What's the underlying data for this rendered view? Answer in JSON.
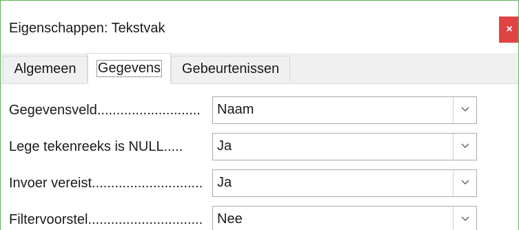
{
  "window": {
    "title": "Eigenschappen: Tekstvak",
    "close_label": "×"
  },
  "tabs": [
    {
      "label": "Algemeen",
      "active": false
    },
    {
      "label": "Gegevens",
      "active": true
    },
    {
      "label": "Gebeurtenissen",
      "active": false
    }
  ],
  "fields": [
    {
      "label": "Gegevensveld...........................",
      "value": "Naam"
    },
    {
      "label": "Lege tekenreeks is NULL.....",
      "value": "Ja"
    },
    {
      "label": "Invoer vereist.............................",
      "value": "Ja"
    },
    {
      "label": "Filtervoorstel..............................",
      "value": "Nee"
    }
  ],
  "icons": {
    "close": "close-icon",
    "dropdown": "chevron-down-icon"
  },
  "colors": {
    "close_button": "#e04343",
    "window_border": "#5fb35a",
    "tab_bar": "#f0f0f0"
  }
}
